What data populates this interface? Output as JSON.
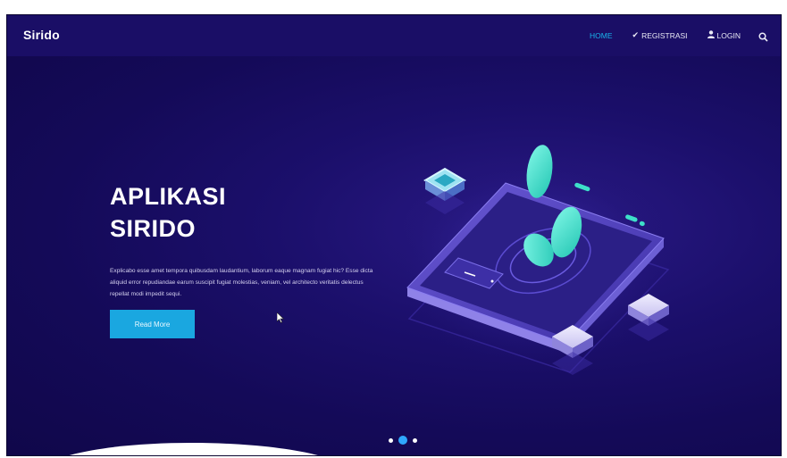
{
  "brand": "Sirido",
  "nav": {
    "home": "HOME",
    "registrasi": "REGISTRASI",
    "login": "LOGIN"
  },
  "hero": {
    "title_line1": "APLIKASI",
    "title_line2": "SIRIDO",
    "paragraph": "Explicabo esse amet tempora quibusdam laudantium, laborum eaque magnam fugiat hic? Esse dicta aliquid error repudiandae earum suscipit fugiat molestias, veniam, vel architecto veritatis delectus repellat modi impedit sequi.",
    "button": "Read More"
  },
  "carousel": {
    "slides": 3,
    "active": 2
  },
  "colors": {
    "background": "#160b5e",
    "accent": "#19b3ea",
    "button": "#1aa7e0",
    "teal": "#3ee0c9"
  },
  "icons": [
    "check-icon",
    "user-icon",
    "search-icon"
  ]
}
